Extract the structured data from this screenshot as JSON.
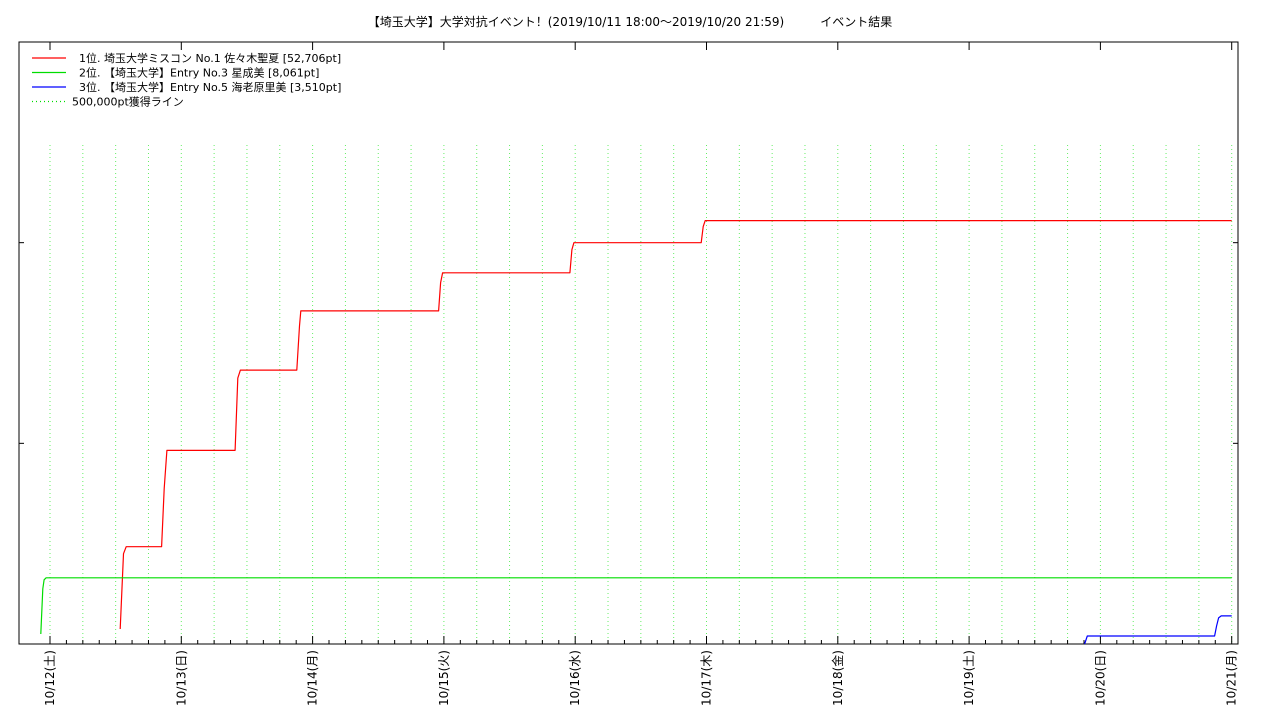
{
  "chart_data": {
    "type": "line",
    "title": "【埼玉大学】大学対抗イベント！(2019/10/11 18:00～2019/10/20 21:59)　　　イベント結果",
    "xlabel": "",
    "ylabel": "",
    "x_unit": "days since 2019/10/12 00:00",
    "xlim": [
      -0.117,
      9.03
    ],
    "ylim": [
      0,
      60000
    ],
    "grid": {
      "x": true,
      "y": false
    },
    "legend_position": "top-left",
    "x_ticks": [
      {
        "x": 0,
        "label": "10/12(土)"
      },
      {
        "x": 1,
        "label": "10/13(日)"
      },
      {
        "x": 2,
        "label": "10/14(月)"
      },
      {
        "x": 3,
        "label": "10/15(火)"
      },
      {
        "x": 4,
        "label": "10/16(水)"
      },
      {
        "x": 5,
        "label": "10/17(木)"
      },
      {
        "x": 6,
        "label": "10/18(金)"
      },
      {
        "x": 7,
        "label": "10/19(土)"
      },
      {
        "x": 8,
        "label": "10/20(日)"
      },
      {
        "x": 9,
        "label": "10/21(月)"
      }
    ],
    "y_ticks": [
      20000,
      40000
    ],
    "series": [
      {
        "name": "1位. 埼玉大学ミスコン No.1 佐々木聖夏 [52,706pt]",
        "color": "#ff0000",
        "style": "solid",
        "points": [
          [
            0.535,
            1500
          ],
          [
            0.56,
            9000
          ],
          [
            0.58,
            9700
          ],
          [
            0.85,
            9700
          ],
          [
            0.87,
            15500
          ],
          [
            0.89,
            19300
          ],
          [
            1.41,
            19300
          ],
          [
            1.43,
            26500
          ],
          [
            1.45,
            27300
          ],
          [
            1.88,
            27300
          ],
          [
            1.9,
            31700
          ],
          [
            1.91,
            33200
          ],
          [
            2.96,
            33200
          ],
          [
            2.975,
            36000
          ],
          [
            2.99,
            37000
          ],
          [
            3.96,
            37000
          ],
          [
            3.975,
            39300
          ],
          [
            3.99,
            40000
          ],
          [
            4.96,
            40000
          ],
          [
            4.975,
            41600
          ],
          [
            4.99,
            42200
          ],
          [
            9.0,
            42200
          ]
        ]
      },
      {
        "name": "2位. 【埼玉大学】Entry No.3 星成美 [8,061pt]",
        "color": "#00dd00",
        "style": "solid",
        "points": [
          [
            -0.07,
            1000
          ],
          [
            -0.055,
            5500
          ],
          [
            -0.045,
            6400
          ],
          [
            -0.03,
            6600
          ],
          [
            9.0,
            6600
          ]
        ]
      },
      {
        "name": "3位. 【埼玉大学】Entry No.5 海老原里美 [3,510pt]",
        "color": "#0000ff",
        "style": "solid",
        "points": [
          [
            7.88,
            0
          ],
          [
            7.9,
            800
          ],
          [
            8.87,
            800
          ],
          [
            8.885,
            1800
          ],
          [
            8.9,
            2600
          ],
          [
            8.92,
            2800
          ],
          [
            9.0,
            2800
          ]
        ]
      },
      {
        "name": "500,000pt獲得ライン",
        "color": "#00dd00",
        "style": "dotted",
        "points": []
      }
    ]
  }
}
